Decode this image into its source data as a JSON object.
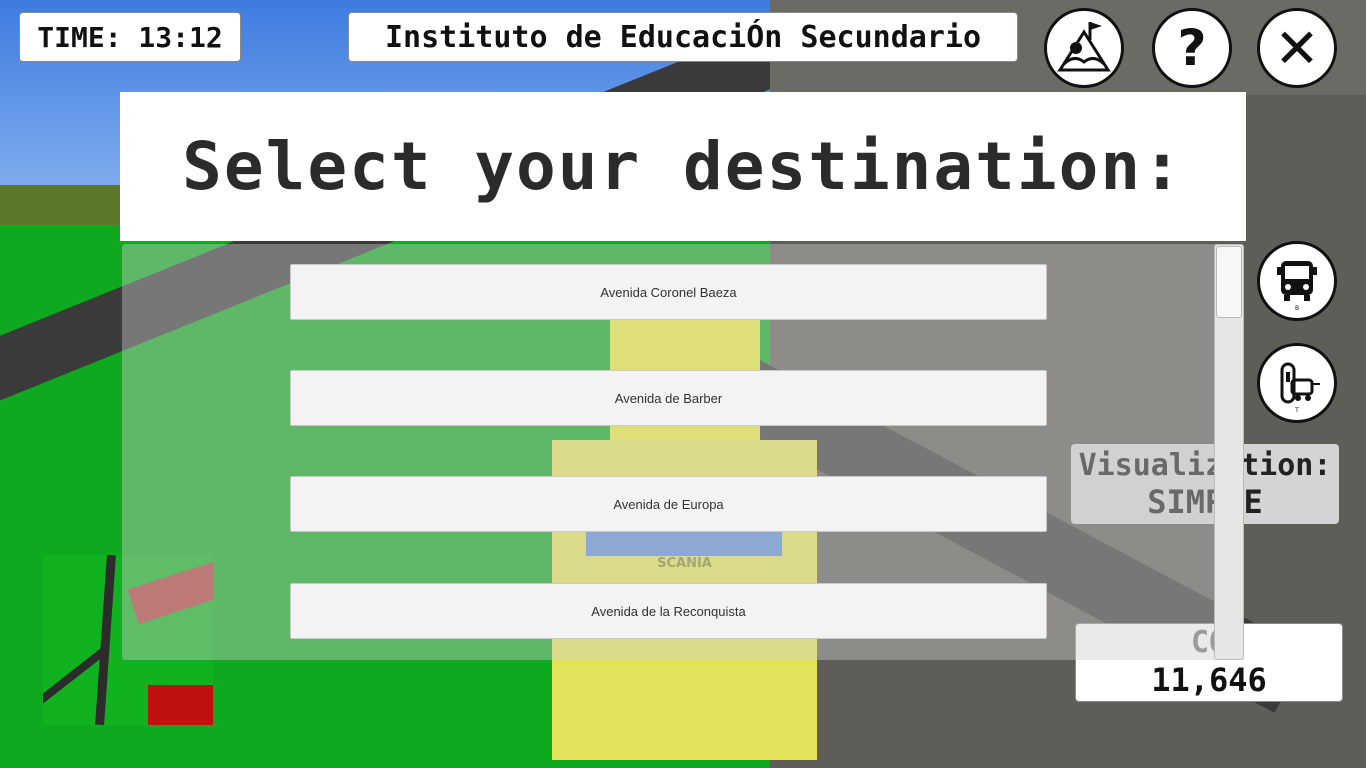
{
  "hud": {
    "time_text": "TIME: 13:12",
    "location_text": "Instituto de EducaciÓn Secundario",
    "visualization_line1": "Visualization:",
    "visualization_line2": "SIMPLE",
    "co2_label": "CO",
    "co2_value": "11,646"
  },
  "buttons": {
    "help_glyph": "?",
    "close_glyph": "✕",
    "bus_caption": "B",
    "tram_caption": "T"
  },
  "dialog": {
    "title": "Select your destination:",
    "destinations": [
      "Avenida Coronel Baeza",
      "Avenida de Barber",
      "Avenida de Europa",
      "Avenida de la Reconquista"
    ],
    "scroll_position": 0.0
  },
  "scene": {
    "bus_brand": "SCANIA"
  },
  "colors": {
    "grass": "#0fa91f",
    "sky": "#3d7be0",
    "bus": "#e3e35a",
    "panel": "#ffffff"
  }
}
